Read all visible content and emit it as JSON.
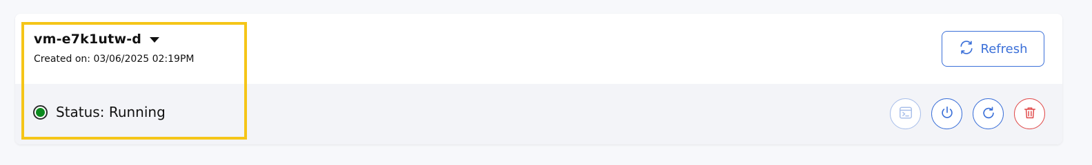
{
  "vm": {
    "name": "vm-e7k1utw-d",
    "created_label": "Created on: 03/06/2025 02:19PM",
    "status_label": "Status: Running",
    "status_color": "#0c8a1e"
  },
  "toolbar": {
    "refresh_label": "Refresh"
  },
  "actions": [
    {
      "name": "console",
      "icon": "terminal-icon",
      "enabled": false
    },
    {
      "name": "power",
      "icon": "power-icon",
      "enabled": true
    },
    {
      "name": "restart",
      "icon": "restart-icon",
      "enabled": true
    },
    {
      "name": "delete",
      "icon": "trash-icon",
      "enabled": true
    }
  ],
  "colors": {
    "accent": "#3a6fd8",
    "danger": "#e04a4a",
    "highlight": "#f5c518",
    "disabled": "#a9bfea"
  }
}
